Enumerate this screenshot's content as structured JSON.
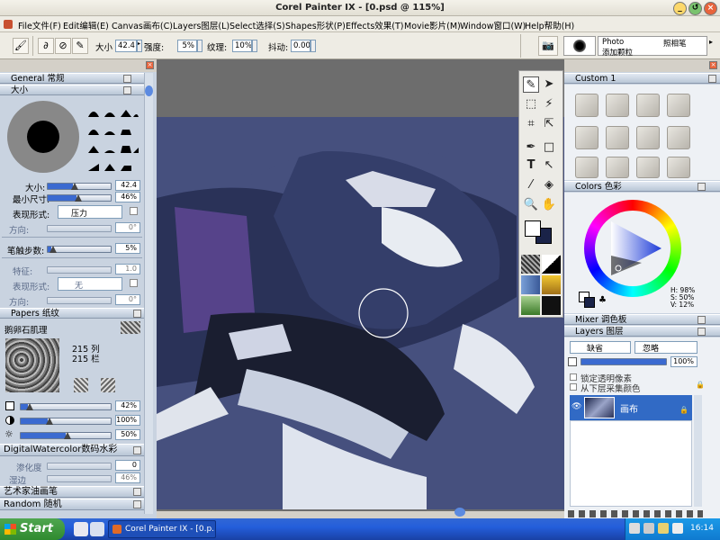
{
  "window": {
    "title": "Corel Painter IX - [0.psd @ 115%]",
    "controls": [
      "_",
      "↺",
      "×"
    ]
  },
  "menu": [
    "File文件(F)",
    "Edit编辑(E)",
    "Canvas画布(C)",
    "Layers图层(L)",
    "Select选择(S)",
    "Shapes形状(P)",
    "Effects效果(T)",
    "Movie影片(M)",
    "Window窗口(W)",
    "Help帮助(H)"
  ],
  "property_bar": {
    "size_label": "大小",
    "size_value": "42.4",
    "opacity_label": "强度:",
    "opacity_value": "5%",
    "grain_label": "纹理:",
    "grain_value": "10%",
    "jitter_label": "抖动:",
    "jitter_value": "0.00",
    "brush_category": "Photo",
    "brush_category_cn": "照相笔",
    "brush_variant": "添加颗粒"
  },
  "brush_controls": {
    "general": {
      "title": "General 常规"
    },
    "size": {
      "title": "大小",
      "size_label": "大小:",
      "size_value": "42.4",
      "min_size_label": "最小尺寸:",
      "min_size_value": "46%",
      "expression_label": "表现形式:",
      "expression_value": "压力",
      "direction_label": "方向:",
      "direction_value": "0°",
      "step_label": "笔触步数:",
      "step_value": "5%",
      "feature_label": "特征:",
      "feature_value": "1.0",
      "expression2_label": "表现形式:",
      "expression2_value": "无",
      "direction2_label": "方向:",
      "direction2_value": "0°"
    }
  },
  "papers": {
    "title": "Papers 纸纹",
    "name": "鹅卵石肌理",
    "cols": "215 列",
    "rows": "215 栏",
    "scale_value": "42%",
    "contrast_value": "100%",
    "brightness_value": "50%"
  },
  "digital_watercolor": {
    "title": "DigitalWatercolor数码水彩",
    "diffusion_label": "渗化度",
    "diffusion_value": "0",
    "edge_label": "湿边",
    "edge_value": "46%"
  },
  "collapsed_sections": [
    "艺术家油画笔",
    "Random 随机"
  ],
  "custom_palette": {
    "title": "Custom  1"
  },
  "colors": {
    "title": "Colors 色彩",
    "h": "H: 98%",
    "s": "S: 50%",
    "v": "V: 12%",
    "primary": "#ffffff",
    "secondary": "#1a2348"
  },
  "mixer": {
    "title": "Mixer 调色板"
  },
  "layers": {
    "title": "Layers 图层",
    "composite_method": "缺省",
    "composite_depth": "忽略",
    "opacity_value": "100%",
    "preserve_label": "锁定透明像素",
    "pick_label": "从下层采集颜色",
    "layer_name": "画布"
  },
  "taskbar": {
    "start": "Start",
    "task": "Corel Painter IX - [0.p...",
    "clock": "16:14"
  },
  "colors_theme": {
    "accent": "#316ac5",
    "canvas_bg": "#46507e"
  }
}
